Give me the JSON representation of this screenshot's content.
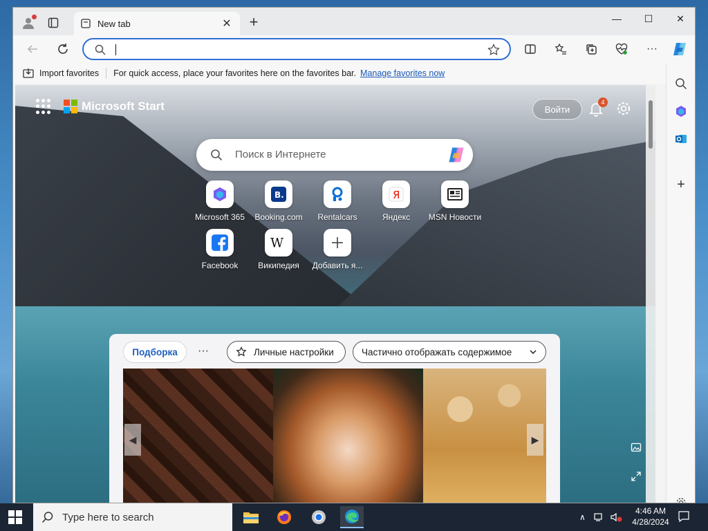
{
  "browser": {
    "tab_title": "New tab",
    "address_value": "",
    "favorites_bar": {
      "import_label": "Import favorites",
      "hint_text": "For quick access, place your favorites here on the favorites bar.",
      "manage_link": "Manage favorites now"
    }
  },
  "start_page": {
    "brand_title": "Microsoft Start",
    "signin_label": "Войти",
    "notification_count": "4",
    "search_placeholder": "Поиск в Интернете",
    "quick_links": [
      {
        "label": "Microsoft 365",
        "icon": "microsoft-365-icon"
      },
      {
        "label": "Booking.com",
        "icon": "booking-icon"
      },
      {
        "label": "Rentalcars",
        "icon": "rentalcars-icon"
      },
      {
        "label": "Яндекс",
        "icon": "yandex-icon"
      },
      {
        "label": "MSN Новости",
        "icon": "msn-news-icon"
      },
      {
        "label": "Facebook",
        "icon": "facebook-icon"
      },
      {
        "label": "Википедия",
        "icon": "wikipedia-icon"
      },
      {
        "label": "Добавить я...",
        "icon": "plus-icon"
      }
    ],
    "feed": {
      "active_tab": "Подборка",
      "more_label": "···",
      "personalize_label": "Личные настройки",
      "content_mode_label": "Частично отображать содержимое"
    }
  },
  "taskbar": {
    "search_placeholder": "Type here to search",
    "time": "4:46 AM",
    "date": "4/28/2024"
  },
  "colors": {
    "accent": "#2f6fd6",
    "link": "#1a59b8",
    "taskbar": "#1c2533"
  }
}
